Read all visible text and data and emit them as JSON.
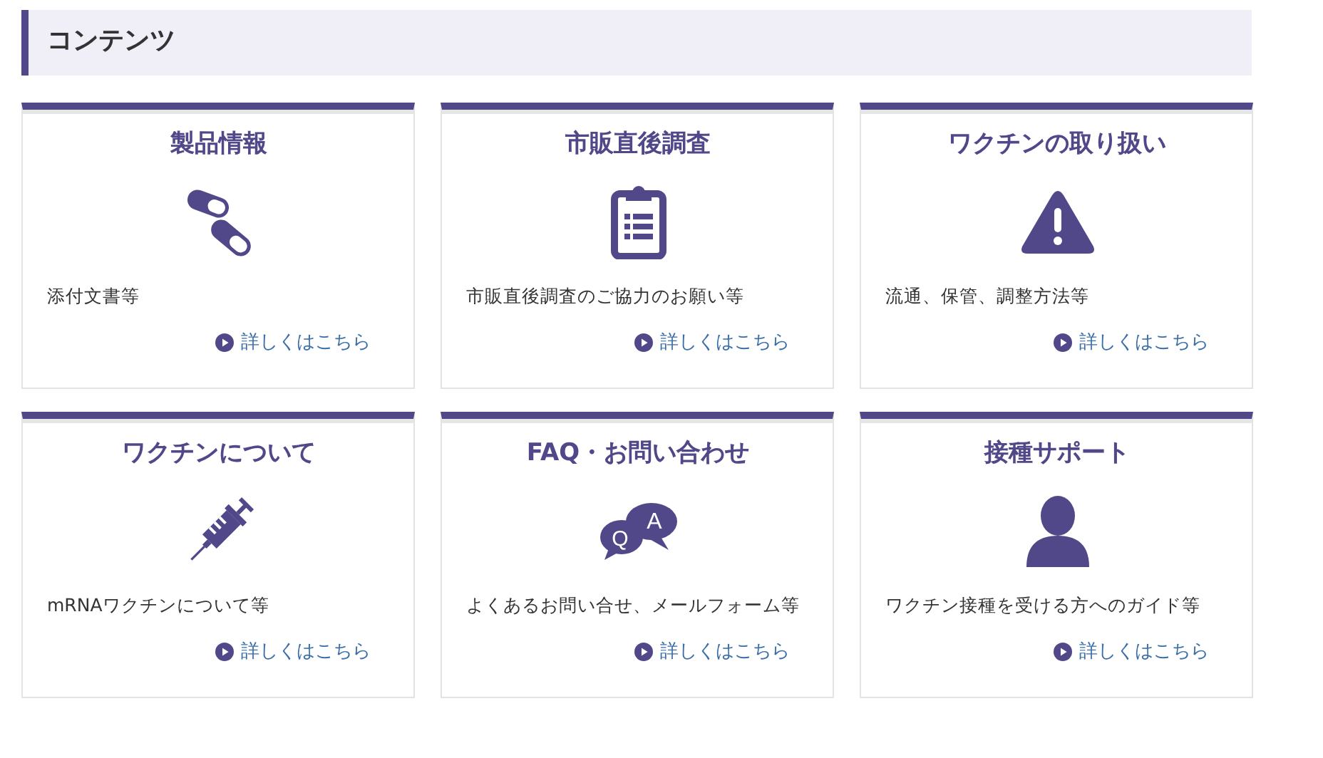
{
  "section_title": "コンテンツ",
  "cards": [
    {
      "title": "製品情報",
      "kind": "pills",
      "description": "添付文書等",
      "link": "詳しくはこちら"
    },
    {
      "title": "市販直後調査",
      "kind": "clipboard",
      "description": "市販直後調査のご協力のお願い等",
      "link": "詳しくはこちら"
    },
    {
      "title": "ワクチンの取り扱い",
      "kind": "warning",
      "description": "流通、保管、調整方法等",
      "link": "詳しくはこちら"
    },
    {
      "title": "ワクチンについて",
      "kind": "syringe",
      "description": "mRNAワクチンについて等",
      "link": "詳しくはこちら"
    },
    {
      "title": "FAQ・お問い合わせ",
      "kind": "qa",
      "icon_letters": [
        "Q",
        "A"
      ],
      "description": "よくあるお問い合せ、メールフォーム等",
      "link": "詳しくはこちら"
    },
    {
      "title": "接種サポート",
      "kind": "person",
      "description": "ワクチン接種を受ける方へのガイド等",
      "link": "詳しくはこちら"
    }
  ]
}
